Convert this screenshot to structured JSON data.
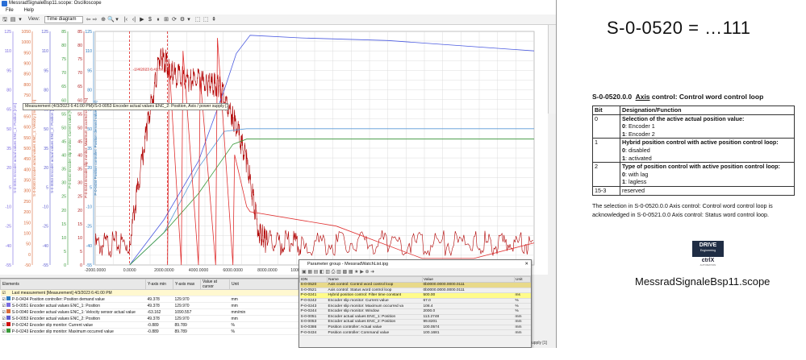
{
  "window": {
    "title": "MessradSignaleBsp11.scope: Oscilloscope",
    "menu": [
      "File",
      "Help"
    ],
    "toolbar": {
      "view_label": "View:",
      "view_value": "Time diagram",
      "glyphs": [
        "🖫",
        "▤",
        "▾",
        "⇦",
        "⇨",
        "⊕",
        "🔍",
        "▾",
        "|‹",
        "‹|",
        "▶",
        "$",
        "⏸",
        "⊞",
        "⟳",
        "⚙",
        "▾",
        "⬚",
        "⬚",
        "⇞"
      ]
    },
    "tooltip": "Measurement (4/3/2023 6:41:00 PM)/S-0-0053 Encoder actual values ENC_2: Position, Axis / power supply [1] Y1_1 [mm]",
    "cursor_label": "-1/4/2023 6:41:00 ..."
  },
  "chart_data": {
    "type": "line",
    "xlabel": "",
    "ylabel": "",
    "x_ticks": [
      "-2000.0000",
      "0.0000",
      "2000.0000",
      "4000.0000",
      "6000.0000",
      "8000.0000",
      "10000.0000",
      "12000.0000"
    ],
    "xlim": [
      -2000,
      23500
    ],
    "y_axes": [
      {
        "name": "S-0-0051 Encoder actual values ENC_1: Position [mm]",
        "color": "#7a6ae0",
        "ticks": [
          "125",
          "110",
          "95",
          "80",
          "65",
          "50",
          "35",
          "20",
          "5",
          "-10",
          "-25",
          "-40",
          "-55"
        ]
      },
      {
        "name": "S-0-0040 Encoder actual values ENC_1: Velocity [mm/min]",
        "color": "#d96a3a",
        "ticks": [
          "1050",
          "1000",
          "950",
          "900",
          "850",
          "800",
          "750",
          "700",
          "650",
          "600",
          "550",
          "500",
          "450",
          "400",
          "350",
          "300",
          "250",
          "200",
          "150",
          "100",
          "50",
          "0",
          "-50"
        ]
      },
      {
        "name": "S-0-0053 Encoder actual values ENC_2: Position [mm]",
        "color": "#5a5ad0",
        "ticks": [
          "125",
          "110",
          "95",
          "80",
          "65",
          "50",
          "35",
          "20",
          "5",
          "-10",
          "-25",
          "-40",
          "-55"
        ]
      },
      {
        "name": "P-0-0242 Encoder slip monitor: Current value [%]",
        "color": "#3a9a3a",
        "ticks": [
          "85",
          "80",
          "75",
          "70",
          "65",
          "60",
          "55",
          "50",
          "45",
          "40",
          "35",
          "30",
          "25",
          "20",
          "15",
          "10",
          "5",
          "0"
        ]
      },
      {
        "name": "P-0-0243 Encoder slip monitor: Maximum occurred value [%]",
        "color": "#b02020",
        "ticks": [
          "85",
          "80",
          "75",
          "70",
          "65",
          "60",
          "55",
          "50",
          "45",
          "40",
          "35",
          "30",
          "25",
          "20",
          "15",
          "10",
          "5",
          "0"
        ]
      },
      {
        "name": "P-0-0434 Position controller: Position demand value [mm]",
        "color": "#2a7ac0",
        "ticks": [
          "125",
          "110",
          "95",
          "80",
          "65",
          "50",
          "35",
          "20",
          "5",
          "-10",
          "-25",
          "-40",
          "-55"
        ]
      }
    ],
    "series": [
      {
        "color": "#b00000",
        "x": [
          -2000,
          0,
          1000,
          1800,
          2500,
          3500,
          4500,
          5200,
          6000,
          6800,
          7500,
          8000,
          10000,
          15000,
          20000,
          23500
        ],
        "y": [
          -40,
          -38,
          50,
          108,
          92,
          88,
          85,
          82,
          60,
          25,
          -30,
          -38,
          -38,
          -38,
          -38,
          -38
        ]
      },
      {
        "color": "#4a5ae0",
        "x": [
          0,
          2000,
          4000,
          5500,
          6200,
          7000,
          10000,
          15000,
          23500
        ],
        "y": [
          -55,
          -20,
          25,
          80,
          108,
          122,
          120,
          118,
          110
        ]
      },
      {
        "color": "#5a9ad8",
        "x": [
          0,
          2000,
          4000,
          5500,
          6800,
          23500
        ],
        "y": [
          -55,
          -30,
          20,
          48,
          50,
          50
        ]
      },
      {
        "color": "#3a9a3a",
        "x": [
          0,
          2000,
          4000,
          6000,
          6800,
          23500
        ],
        "y": [
          -55,
          -30,
          0,
          38,
          42,
          42
        ]
      },
      {
        "color": "#e03030",
        "x": [
          2200,
          2300,
          3000,
          3100,
          4000,
          4100,
          5000,
          5100,
          6000,
          6100,
          6800,
          7000,
          12000,
          17000,
          20000,
          23500
        ],
        "y": [
          -55,
          100,
          -55,
          110,
          -55,
          90,
          -55,
          120,
          -55,
          30,
          -10,
          -14,
          -25,
          -50,
          -50,
          -38
        ]
      }
    ]
  },
  "elements_panel": {
    "headers": [
      "Elements",
      "Y-axis min",
      "Y-axis max",
      "Value at cursor",
      "Unit"
    ],
    "rows": [
      {
        "label": "Last measurement [Measurement] 4/3/2023 6:41:00 PM",
        "color": "",
        "min": "",
        "max": "",
        "val": "",
        "unit": ""
      },
      {
        "label": "P-0-0434 Position controller: Position demand value",
        "color": "#2a7ac0",
        "min": "49.378",
        "max": "129.970",
        "val": "",
        "unit": "mm"
      },
      {
        "label": "S-0-0051 Encoder actual values ENC_1: Position",
        "color": "#7a6ae0",
        "min": "49.378",
        "max": "129.970",
        "val": "",
        "unit": "mm"
      },
      {
        "label": "S-0-0040 Encoder actual values ENC_1: Velocity sensor actual value",
        "color": "#d96a3a",
        "min": "-63.162",
        "max": "1090.557",
        "val": "",
        "unit": "mm/min"
      },
      {
        "label": "S-0-0053 Encoder actual values ENC_2: Position",
        "color": "#5a5ad0",
        "min": "49.378",
        "max": "129.970",
        "val": "",
        "unit": "mm"
      },
      {
        "label": "P-0-0242 Encoder slip monitor: Current value",
        "color": "#d01010",
        "min": "-0.889",
        "max": "89.789",
        "val": "",
        "unit": "%"
      },
      {
        "label": "P-0-0243 Encoder slip monitor: Maximum occurred value",
        "color": "#3a9a3a",
        "min": "-0.889",
        "max": "89.789",
        "val": "",
        "unit": "%"
      }
    ],
    "side_right": [
      "Axis / power supply [1] Y1_1",
      "Axis / power supply [1] Y1_1"
    ]
  },
  "param_window": {
    "title": "Parameter group - MessradWatchList.ipg",
    "headers": [
      "IDN",
      "Name",
      "Value",
      "Unit"
    ],
    "rows": [
      {
        "idn": "S-0-0520",
        "name": "Axis control: Control word control loop",
        "value": "0b0000.0000.0000.0111",
        "unit": "",
        "cls": "sel"
      },
      {
        "idn": "S-0-0521",
        "name": "Axis control: Status word control loop",
        "value": "0b0000.0000.0000.0111",
        "unit": "",
        "cls": ""
      },
      {
        "idn": "P-0-0241",
        "name": "Hybrid position control: Filter time constant",
        "value": "500.00",
        "unit": "ms",
        "cls": "hl"
      },
      {
        "idn": "P-0-0242",
        "name": "Encoder slip monitor: Current value",
        "value": "67.0",
        "unit": "%",
        "cls": ""
      },
      {
        "idn": "P-0-0243",
        "name": "Encoder slip monitor: Maximum occurred va",
        "value": "108.4",
        "unit": "%",
        "cls": ""
      },
      {
        "idn": "P-0-0244",
        "name": "Encoder slip monitor: Window",
        "value": "2000.0",
        "unit": "%",
        "cls": ""
      },
      {
        "idn": "S-0-0051",
        "name": "Encoder actual values ENC_1: Position",
        "value": "113.2748",
        "unit": "mm",
        "cls": ""
      },
      {
        "idn": "S-0-0053",
        "name": "Encoder actual values ENC_2: Position",
        "value": "99.8201",
        "unit": "mm",
        "cls": ""
      },
      {
        "idn": "S-0-0386",
        "name": "Position controller: Actual value",
        "value": "100.0574",
        "unit": "mm",
        "cls": ""
      },
      {
        "idn": "P-0-0434",
        "name": "Position controller: Command value",
        "value": "100.1681",
        "unit": "mm",
        "cls": ""
      }
    ]
  },
  "doc": {
    "heading": "S-0-0520 = …111",
    "section_code": "S-0-0520.0.0",
    "section_title": "Axis control: Control word control loop",
    "table_header": [
      "Bit",
      "Designation/Function"
    ],
    "bits": [
      {
        "bit": "0",
        "title": "Selection of the active actual position value:",
        "o0": "0",
        "o0t": ": Encoder 1",
        "o1": "1",
        "o1t": ": Encoder 2"
      },
      {
        "bit": "1",
        "title": "Hybrid position control with active position control loop:",
        "o0": "0",
        "o0t": ": disabled",
        "o1": "1",
        "o1t": ": activated"
      },
      {
        "bit": "2",
        "title": "Type of position control with active position control loop:",
        "o0": "0",
        "o0t": ": with lag",
        "o1": "1",
        "o1t": ": lagless"
      }
    ],
    "reserved_bit": "15-3",
    "reserved_label": "reserved",
    "note": "The selection in S-0-0520.0.0 Axis control: Control word control loop is acknowledged in S-0-0521.0.0 Axis control: Status word control loop.",
    "logo_top": "DRIVE",
    "logo_sub": "Engineering",
    "logo_brand": "ctrlX",
    "logo_tag": "AUTOMATION",
    "filename": "MessradSignaleBsp11.scope"
  }
}
